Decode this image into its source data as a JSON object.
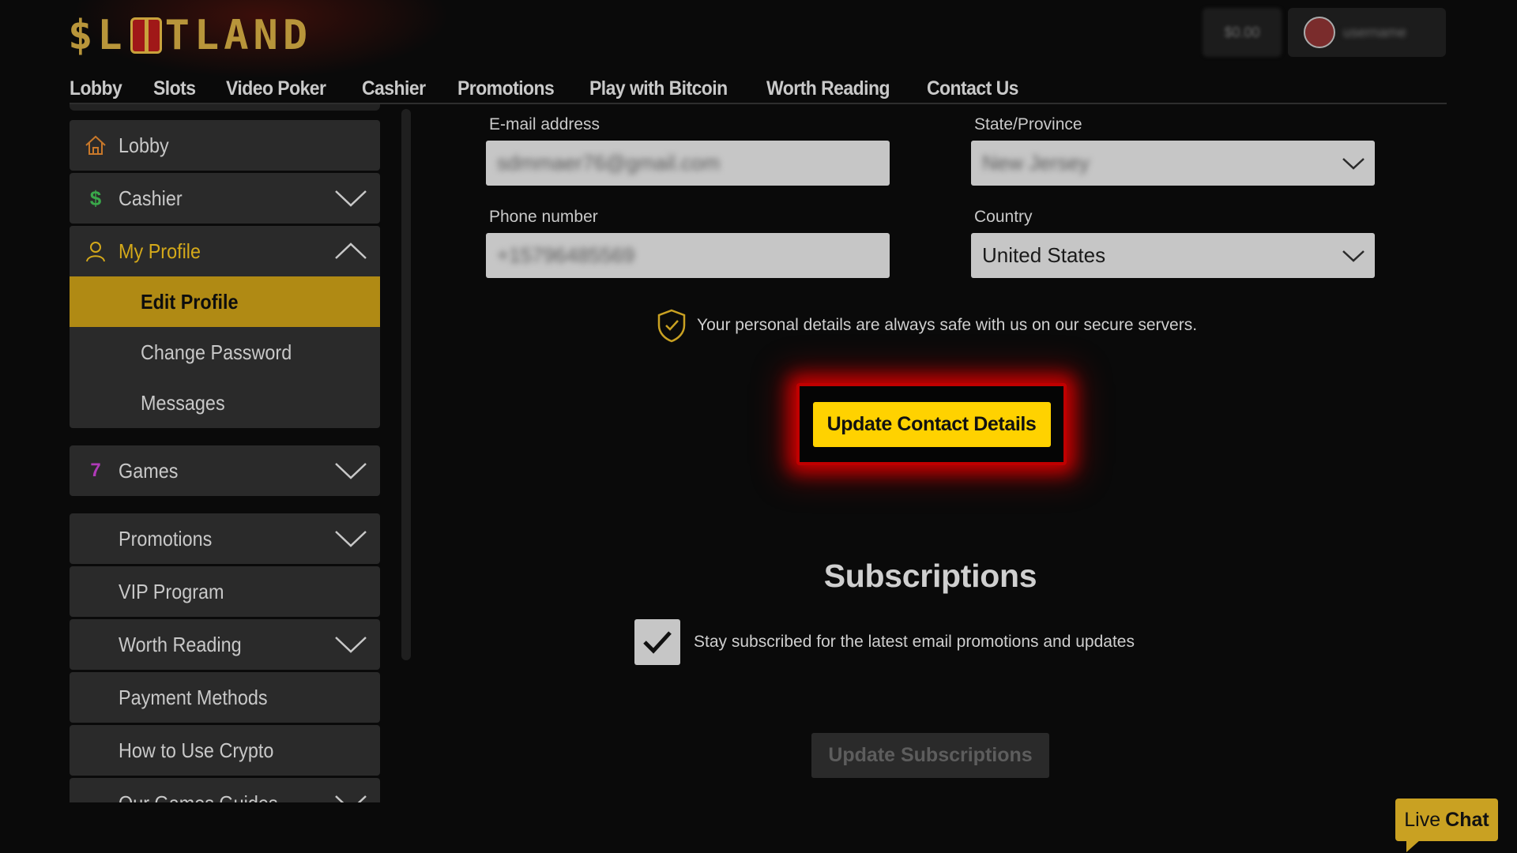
{
  "header": {
    "logo_text": "SLOTLAND",
    "balance": "$0.00",
    "username": "username"
  },
  "topnav": [
    "Lobby",
    "Slots",
    "Video Poker",
    "Cashier",
    "Promotions",
    "Play with Bitcoin",
    "Worth Reading",
    "Contact Us"
  ],
  "sidebar": {
    "lobby": "Lobby",
    "cashier": "Cashier",
    "my_profile": "My Profile",
    "profile_sub": [
      "Edit Profile",
      "Change Password",
      "Messages"
    ],
    "games": "Games",
    "promotions": "Promotions",
    "vip": "VIP Program",
    "worth_reading": "Worth Reading",
    "payment_methods": "Payment Methods",
    "how_to_crypto": "How to Use Crypto",
    "partial_item": "Our Games Guides"
  },
  "form": {
    "email_label": "E-mail address",
    "email_value": "sdmmaer76@gmail.com",
    "state_label": "State/Province",
    "state_value": "New Jersey",
    "phone_label": "Phone number",
    "phone_value": "+15796485569",
    "country_label": "Country",
    "country_value": "United States",
    "secure_note": "Your personal details are always safe with us on our secure servers.",
    "update_contact_button": "Update Contact Details"
  },
  "subscriptions": {
    "title": "Subscriptions",
    "checkbox_label": "Stay subscribed for the latest email promotions and updates",
    "checked": true,
    "update_button": "Update Subscriptions"
  },
  "live_chat": {
    "live": "Live",
    "chat": "Chat"
  },
  "colors": {
    "accent": "#ffd200",
    "selected": "#b08a14",
    "highlight_frame": "#c00000"
  }
}
